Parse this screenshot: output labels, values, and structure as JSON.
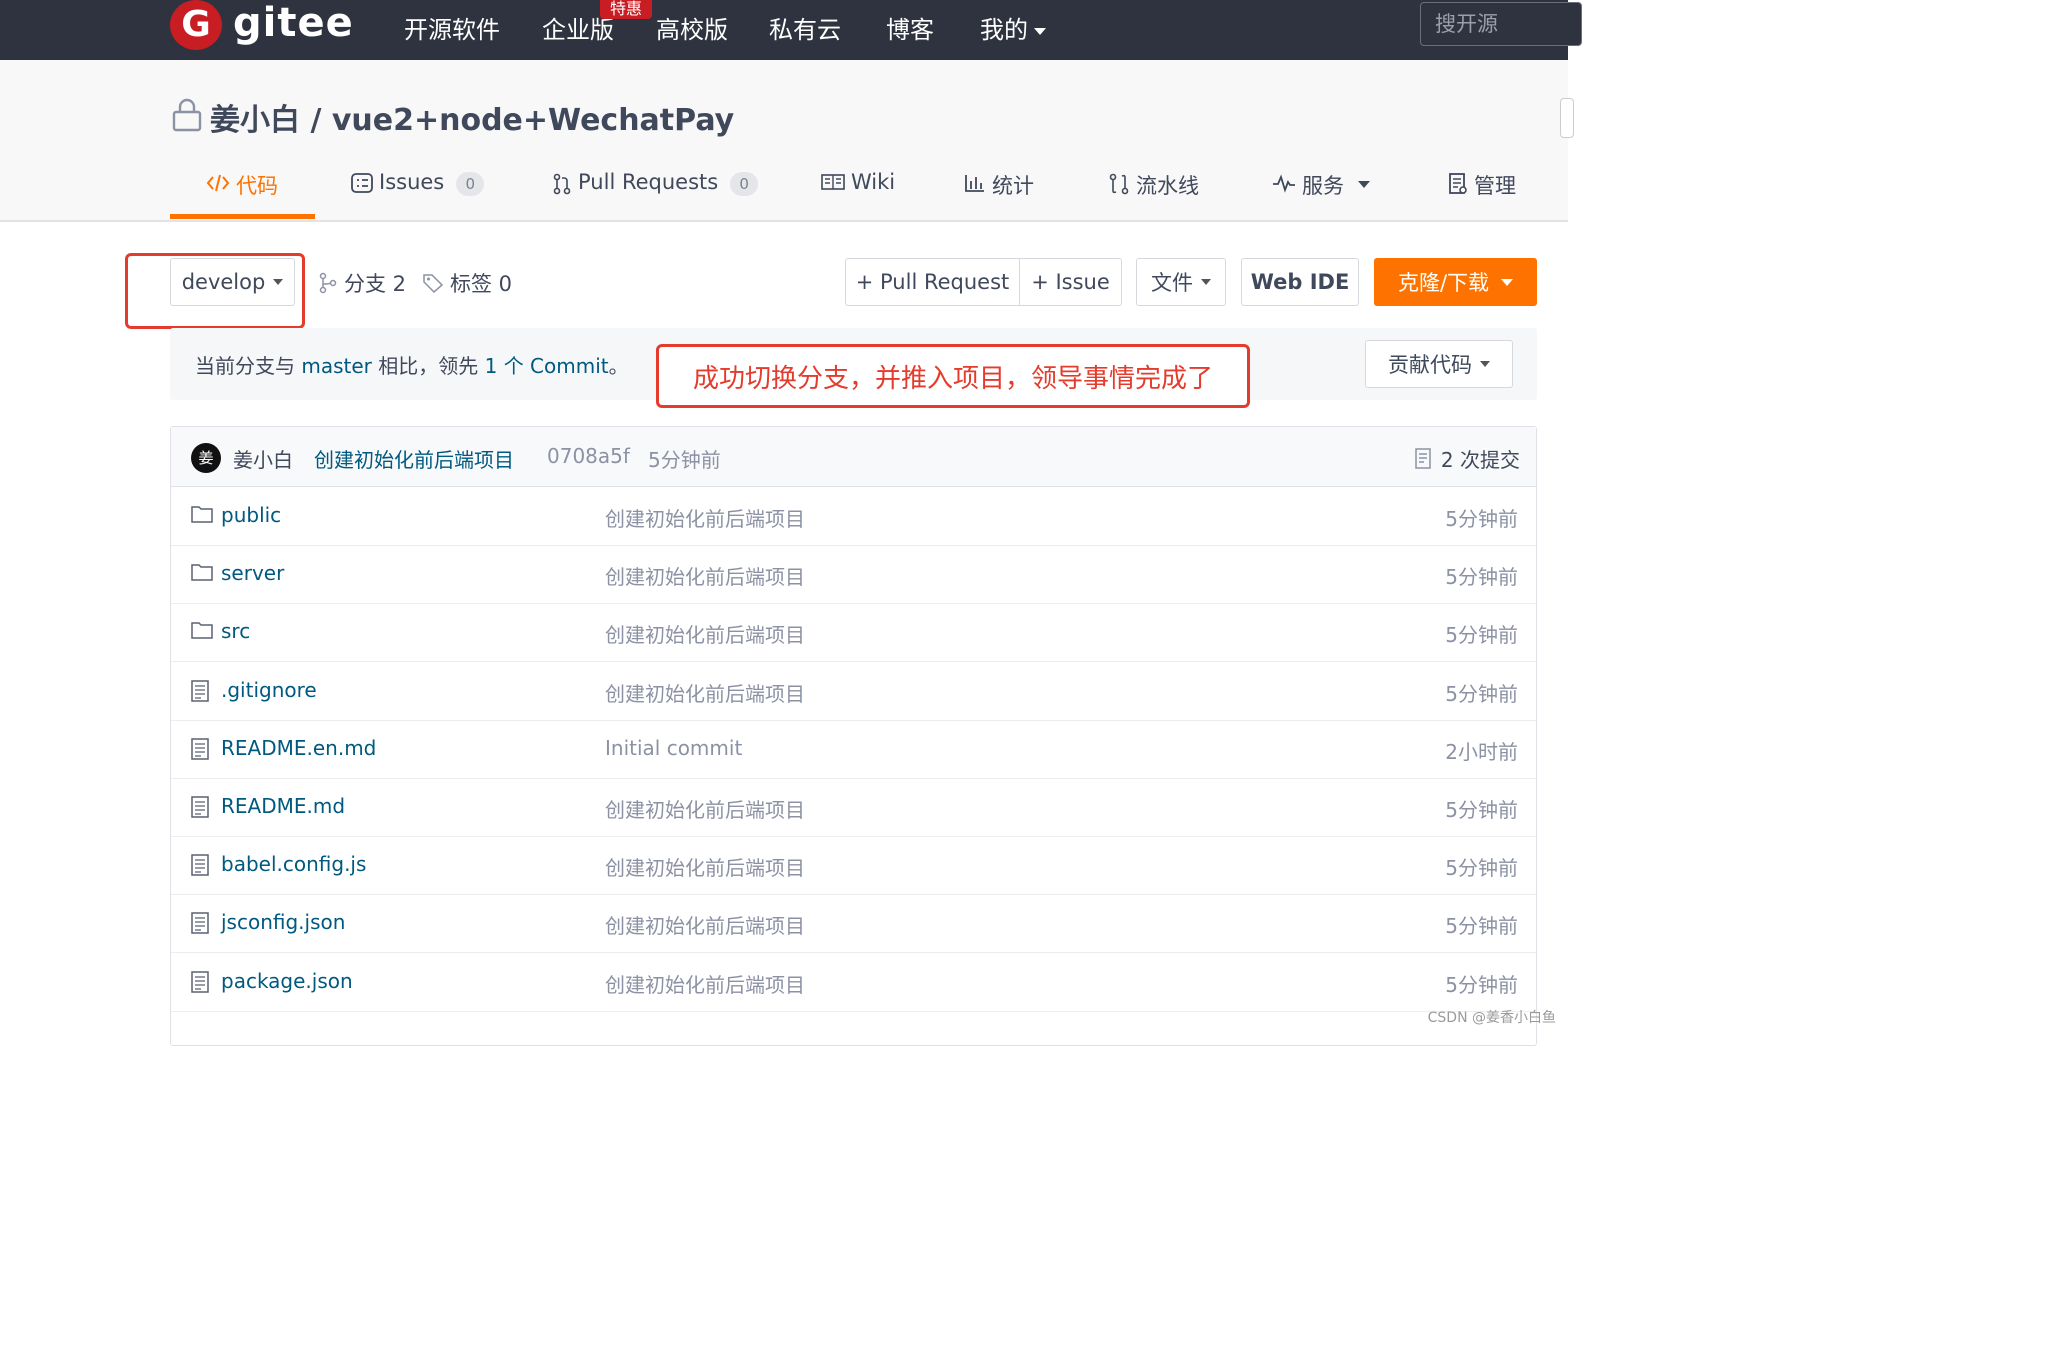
{
  "nav": {
    "logo_letter": "G",
    "logo_text": "gitee",
    "items": [
      "开源软件",
      "企业版",
      "高校版",
      "私有云",
      "博客",
      "我的"
    ],
    "badge": "特惠",
    "search_placeholder": "搜开源"
  },
  "repo": {
    "title": "姜小白 / vue2+node+WechatPay",
    "tabs": [
      {
        "label": "代码",
        "icon": "code-icon"
      },
      {
        "label": "Issues",
        "count": "0",
        "icon": "issues-icon"
      },
      {
        "label": "Pull Requests",
        "count": "0",
        "icon": "pull-request-icon"
      },
      {
        "label": "Wiki",
        "icon": "wiki-icon"
      },
      {
        "label": "统计",
        "icon": "stats-icon"
      },
      {
        "label": "流水线",
        "icon": "pipeline-icon"
      },
      {
        "label": "服务",
        "icon": "service-icon"
      },
      {
        "label": "管理",
        "icon": "manage-icon"
      }
    ]
  },
  "toolbar": {
    "branch": "develop",
    "branches": "分支 2",
    "tags": "标签 0",
    "pull_request": "+ Pull Request",
    "issue": "+ Issue",
    "file": "文件",
    "web_ide": "Web IDE",
    "clone": "克隆/下载",
    "contribute": "贡献代码"
  },
  "compare": {
    "prefix": "当前分支与 ",
    "branch": "master",
    "middle": " 相比，领先 ",
    "commits": "1 个 Commit",
    "suffix": "。"
  },
  "annotation": "成功切换分支，并推入项目，领导事情完成了",
  "commit": {
    "avatar": "姜",
    "user": "姜小白",
    "message": "创建初始化前后端项目",
    "hash": "0708a5f",
    "time": "5分钟前",
    "count": "2 次提交"
  },
  "files": [
    {
      "name": "public",
      "type": "folder",
      "message": "创建初始化前后端项目",
      "time": "5分钟前"
    },
    {
      "name": "server",
      "type": "folder",
      "message": "创建初始化前后端项目",
      "time": "5分钟前"
    },
    {
      "name": "src",
      "type": "folder",
      "message": "创建初始化前后端项目",
      "time": "5分钟前"
    },
    {
      "name": ".gitignore",
      "type": "file",
      "message": "创建初始化前后端项目",
      "time": "5分钟前"
    },
    {
      "name": "README.en.md",
      "type": "file",
      "message": "Initial commit",
      "time": "2小时前"
    },
    {
      "name": "README.md",
      "type": "file",
      "message": "创建初始化前后端项目",
      "time": "5分钟前"
    },
    {
      "name": "babel.config.js",
      "type": "file",
      "message": "创建初始化前后端项目",
      "time": "5分钟前"
    },
    {
      "name": "jsconfig.json",
      "type": "file",
      "message": "创建初始化前后端项目",
      "time": "5分钟前"
    },
    {
      "name": "package.json",
      "type": "file",
      "message": "创建初始化前后端项目",
      "time": "5分钟前"
    }
  ],
  "watermark": "CSDN @姜香小白鱼",
  "colors": {
    "accent": "#fe7300",
    "nav_bg": "#2e333f",
    "link": "#005980",
    "annotation": "#e53b2c",
    "logo": "#c71d23"
  }
}
